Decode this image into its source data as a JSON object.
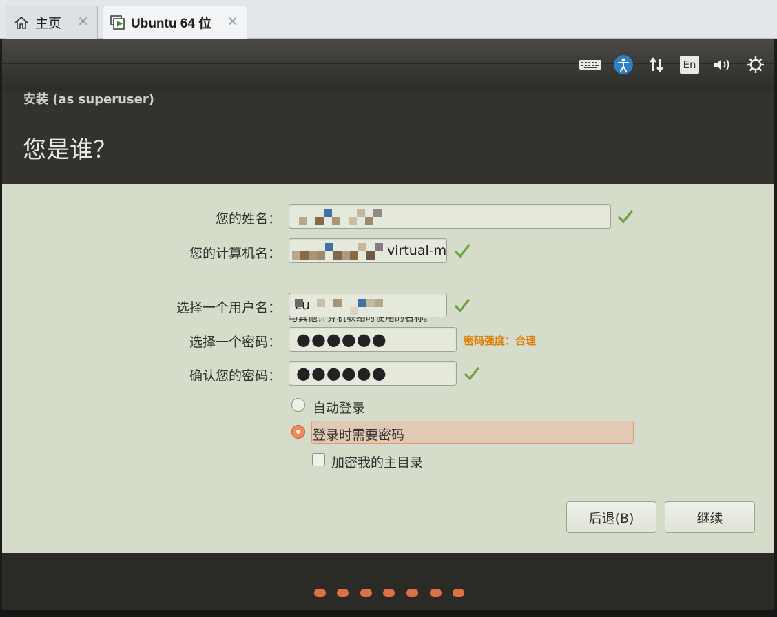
{
  "browser_tabs": [
    {
      "label": "主页",
      "icon": "home-icon"
    },
    {
      "label": "Ubuntu 64 位",
      "icon": "vm-play-icon"
    }
  ],
  "tab_close_glyph": "✕",
  "panel": {
    "indicators": [
      "keyboard-icon",
      "accessibility-icon",
      "network-icon",
      "language-icon",
      "volume-icon",
      "power-gear-icon"
    ],
    "language_label": "En"
  },
  "installer": {
    "subtitle": "安装 (as superuser)",
    "title": "您是谁？"
  },
  "form": {
    "name_label": "您的姓名：",
    "name_value": "",
    "computer_label": "您的计算机名：",
    "computer_value": "virtual-m",
    "computer_hint": "与其他计算机联络时使用的名称。",
    "username_label": "选择一个用户名：",
    "username_value": "zu",
    "password_label": "选择一个密码：",
    "password_value": "●●●●●●",
    "password_strength": "密码强度：合理",
    "confirm_label": "确认您的密码：",
    "confirm_value": "●●●●●●"
  },
  "options": {
    "auto_login": "自动登录",
    "require_password": "登录时需要密码",
    "encrypt_home": "加密我的主目录",
    "selected": "require_password",
    "encrypt_checked": false
  },
  "buttons": {
    "back": "后退(B)",
    "continue": "继续"
  },
  "progress": {
    "total_steps": 7
  },
  "colors": {
    "accent": "#dd7146",
    "form_bg": "#d5dcc9",
    "header_bg": "#33322e",
    "check_green": "#6fa23a",
    "strength_orange": "#e07b00"
  }
}
